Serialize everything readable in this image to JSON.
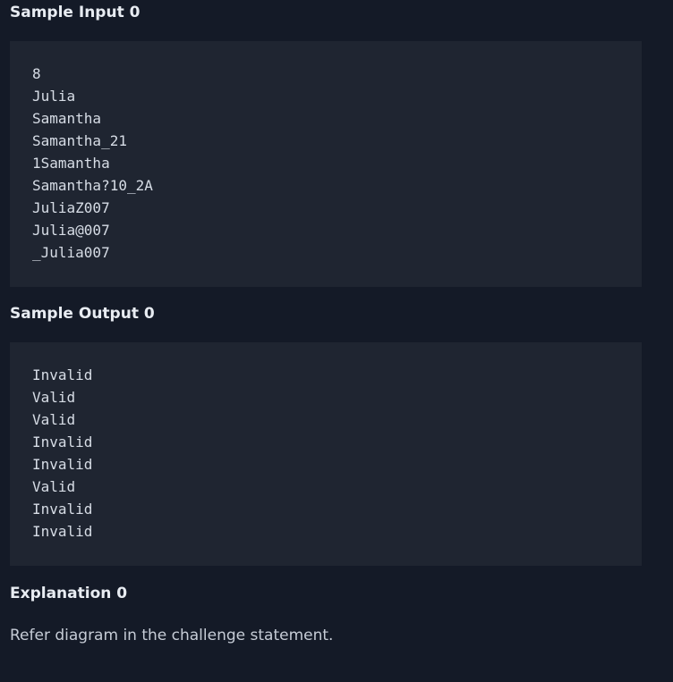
{
  "sample_input": {
    "heading": "Sample Input 0",
    "lines": [
      "8",
      "Julia",
      "Samantha",
      "Samantha_21",
      "1Samantha",
      "Samantha?10_2A",
      "JuliaZ007",
      "Julia@007",
      "_Julia007"
    ]
  },
  "sample_output": {
    "heading": "Sample Output 0",
    "lines": [
      "Invalid",
      "Valid",
      "Valid",
      "Invalid",
      "Invalid",
      "Valid",
      "Invalid",
      "Invalid"
    ]
  },
  "explanation": {
    "heading": "Explanation 0",
    "text": "Refer diagram in the challenge statement."
  }
}
